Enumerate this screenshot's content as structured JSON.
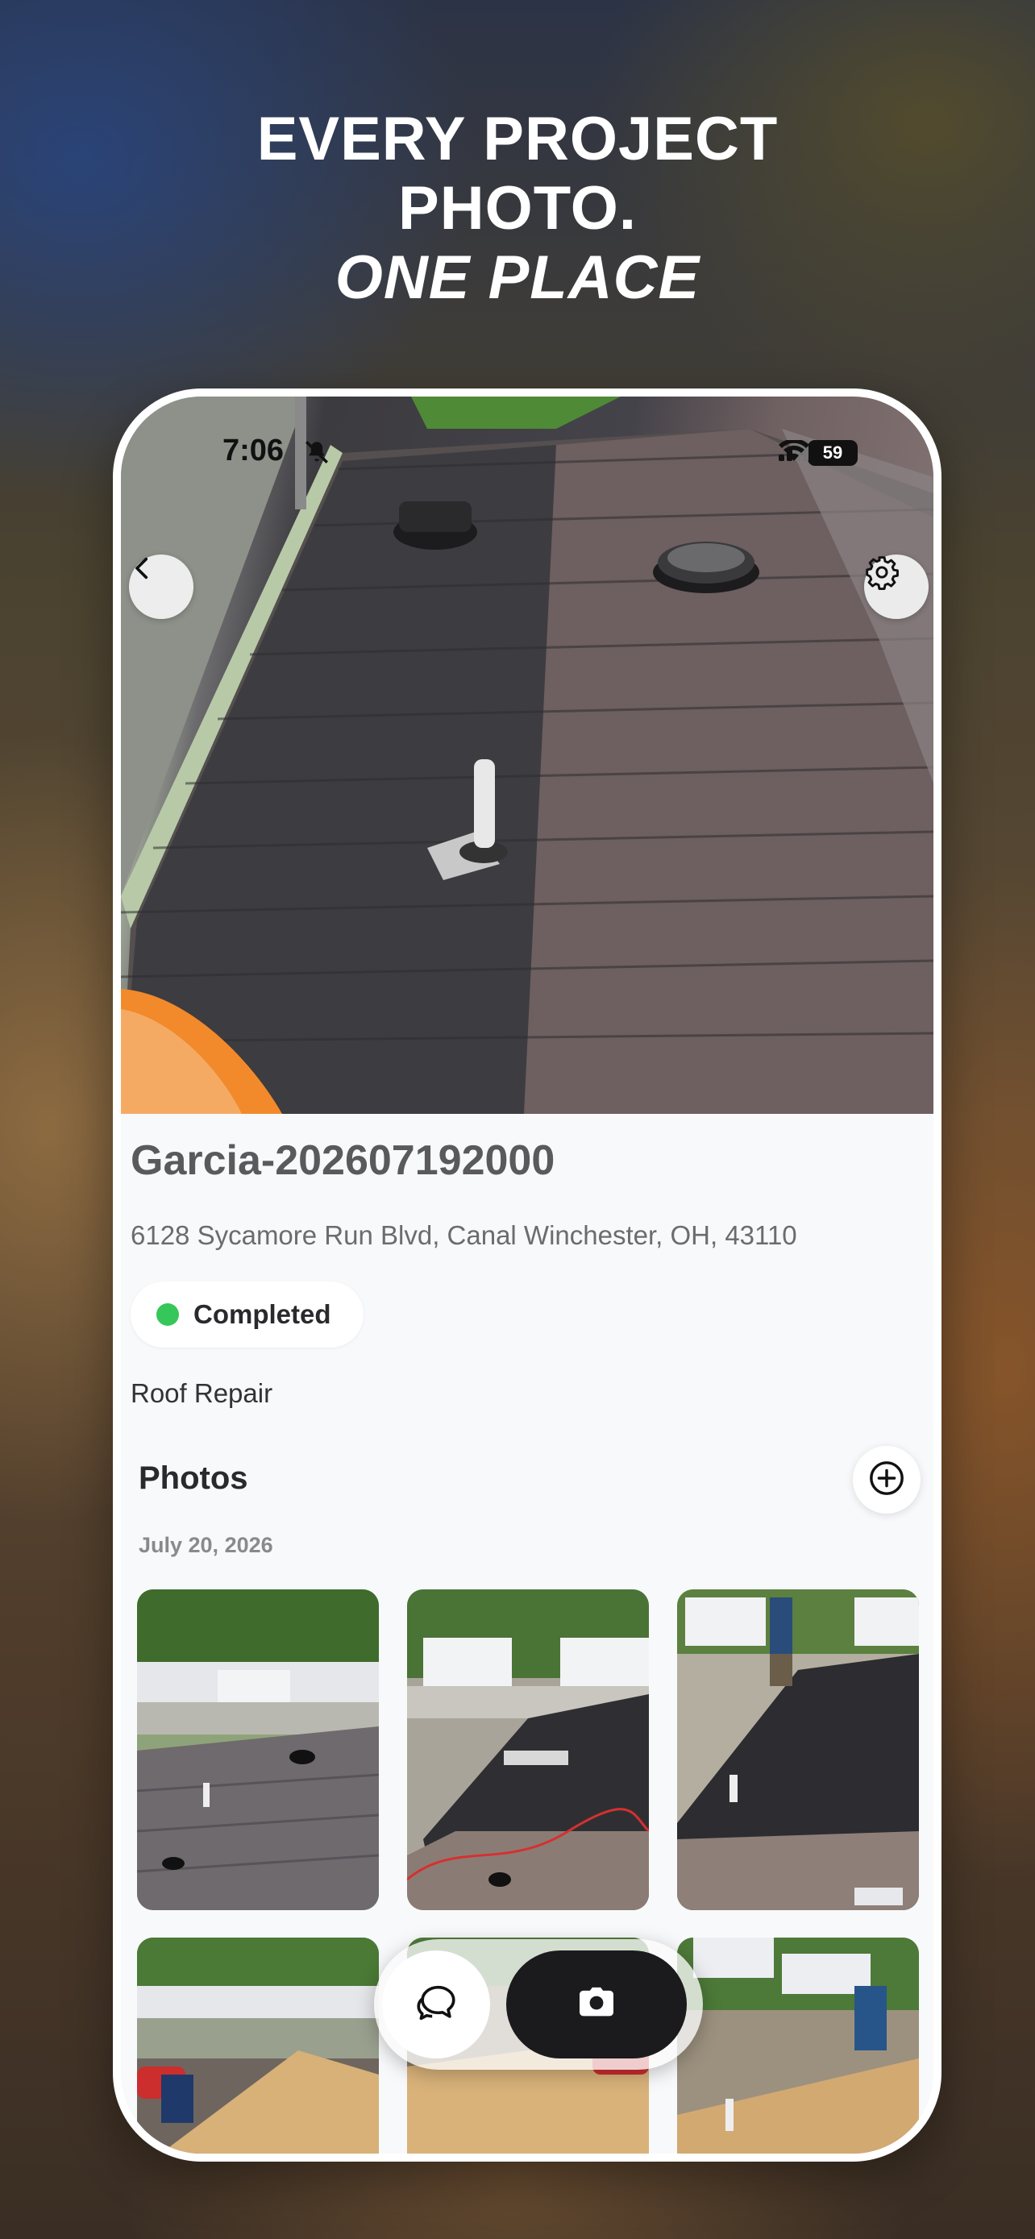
{
  "marketing": {
    "line1": "EVERY PROJECT",
    "line2": "PHOTO.",
    "line3": "ONE PLACE"
  },
  "status_bar": {
    "time": "7:06",
    "battery": "59"
  },
  "icons": {
    "back": "chevron-left-icon",
    "settings": "gear-icon",
    "add": "plus-circle-icon",
    "chat": "chat-bubbles-icon",
    "camera": "camera-icon"
  },
  "project": {
    "title": "Garcia-202607192000",
    "address": "6128 Sycamore Run Blvd, Canal Winchester, OH, 43110",
    "status": "Completed",
    "status_color": "#35c759",
    "category": "Roof Repair"
  },
  "photos": {
    "section_title": "Photos",
    "date": "July 20, 2026"
  }
}
